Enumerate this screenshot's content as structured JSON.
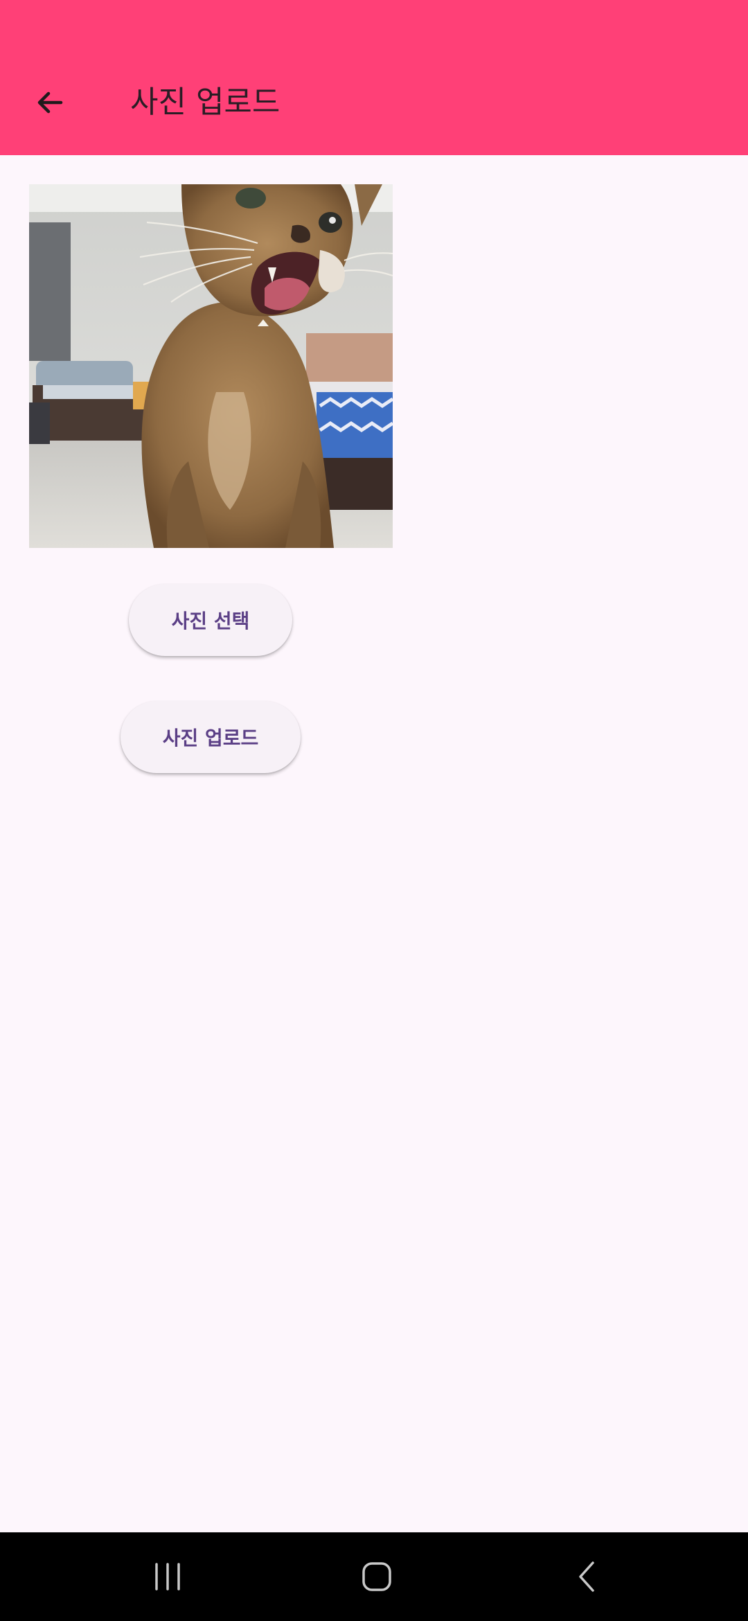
{
  "app_bar": {
    "title": "사진 업로드",
    "background_color": "#ff4077",
    "back_icon": "arrow-left-icon"
  },
  "photo": {
    "subject": "cat-photo"
  },
  "buttons": {
    "select_label": "사진 선택",
    "upload_label": "사진 업로드",
    "text_color": "#5b3f86"
  },
  "nav_bar": {
    "recent_icon": "recent-apps-icon",
    "home_icon": "home-icon",
    "back_icon": "back-icon"
  }
}
